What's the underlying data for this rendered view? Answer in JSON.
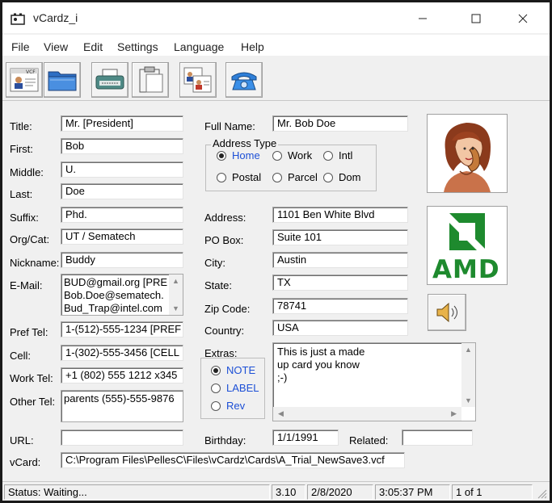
{
  "window": {
    "title": "vCardz_i",
    "minimize_icon": "minimize-icon",
    "maximize_icon": "maximize-icon",
    "close_icon": "close-icon"
  },
  "menu": [
    "File",
    "View",
    "Edit",
    "Settings",
    "Language",
    "Help"
  ],
  "toolbar": {
    "buttons": [
      "vcf-card-icon",
      "open-folder-icon",
      "typewriter-icon",
      "clipboard-icon",
      "contact-cards-icon",
      "telephone-icon"
    ]
  },
  "form": {
    "title_label": "Title:",
    "title_value": "Mr.  [President]",
    "first_label": "First:",
    "first_value": "Bob",
    "middle_label": "Middle:",
    "middle_value": "U.",
    "last_label": "Last:",
    "last_value": "Doe",
    "suffix_label": "Suffix:",
    "suffix_value": "Phd.",
    "org_label": "Org/Cat:",
    "org_value": "UT / Sematech",
    "nickname_label": "Nickname:",
    "nickname_value": "Buddy",
    "email_label": "E-Mail:",
    "email_lines": [
      "BUD@gmail.org [PRE",
      "Bob.Doe@sematech.",
      "Bud_Trap@intel.com"
    ],
    "preftel_label": "Pref Tel:",
    "preftel_value": "1-(512)-555-1234 [PREF",
    "cell_label": "Cell:",
    "cell_value": "1-(302)-555-3456 [CELL",
    "worktel_label": "Work Tel:",
    "worktel_value": "+1 (802) 555 1212 x345",
    "othertel_label": "Other Tel:",
    "othertel_value": "parents (555)-555-9876",
    "url_label": "URL:",
    "url_value": "",
    "vcard_label": "vCard:",
    "vcard_value": "C:\\Program Files\\PellesC\\Files\\vCardz\\Cards\\A_Trial_NewSave3.vcf",
    "fullname_label": "Full Name:",
    "fullname_value": "Mr. Bob Doe",
    "address_type": {
      "title": "Address Type",
      "options": [
        "Home",
        "Work",
        "Intl",
        "Postal",
        "Parcel",
        "Dom"
      ],
      "selected": "Home"
    },
    "address_label": "Address:",
    "address_value": "1101 Ben White Blvd",
    "pobox_label": "PO Box:",
    "pobox_value": "Suite 101",
    "city_label": "City:",
    "city_value": "Austin",
    "state_label": "State:",
    "state_value": "TX",
    "zip_label": "Zip Code:",
    "zip_value": "78741",
    "country_label": "Country:",
    "country_value": "USA",
    "extras_label": "Extras:",
    "extras_options": [
      "NOTE",
      "LABEL",
      "Rev"
    ],
    "extras_selected": "NOTE",
    "extras_lines": [
      "This is just a made",
      "up card you know",
      ";-)"
    ],
    "birthday_label": "Birthday:",
    "birthday_value": "1/1/1991",
    "related_label": "Related:",
    "related_value": ""
  },
  "images": {
    "photo": "woman-on-phone-photo",
    "logo_text": "AMD",
    "logo_color": "#1e8a2e",
    "sound_button": "speaker-icon"
  },
  "status": {
    "text": "Status: Waiting...",
    "version": "3.10",
    "date": "2/8/2020",
    "time": "3:05:37 PM",
    "record": "1 of 1"
  }
}
